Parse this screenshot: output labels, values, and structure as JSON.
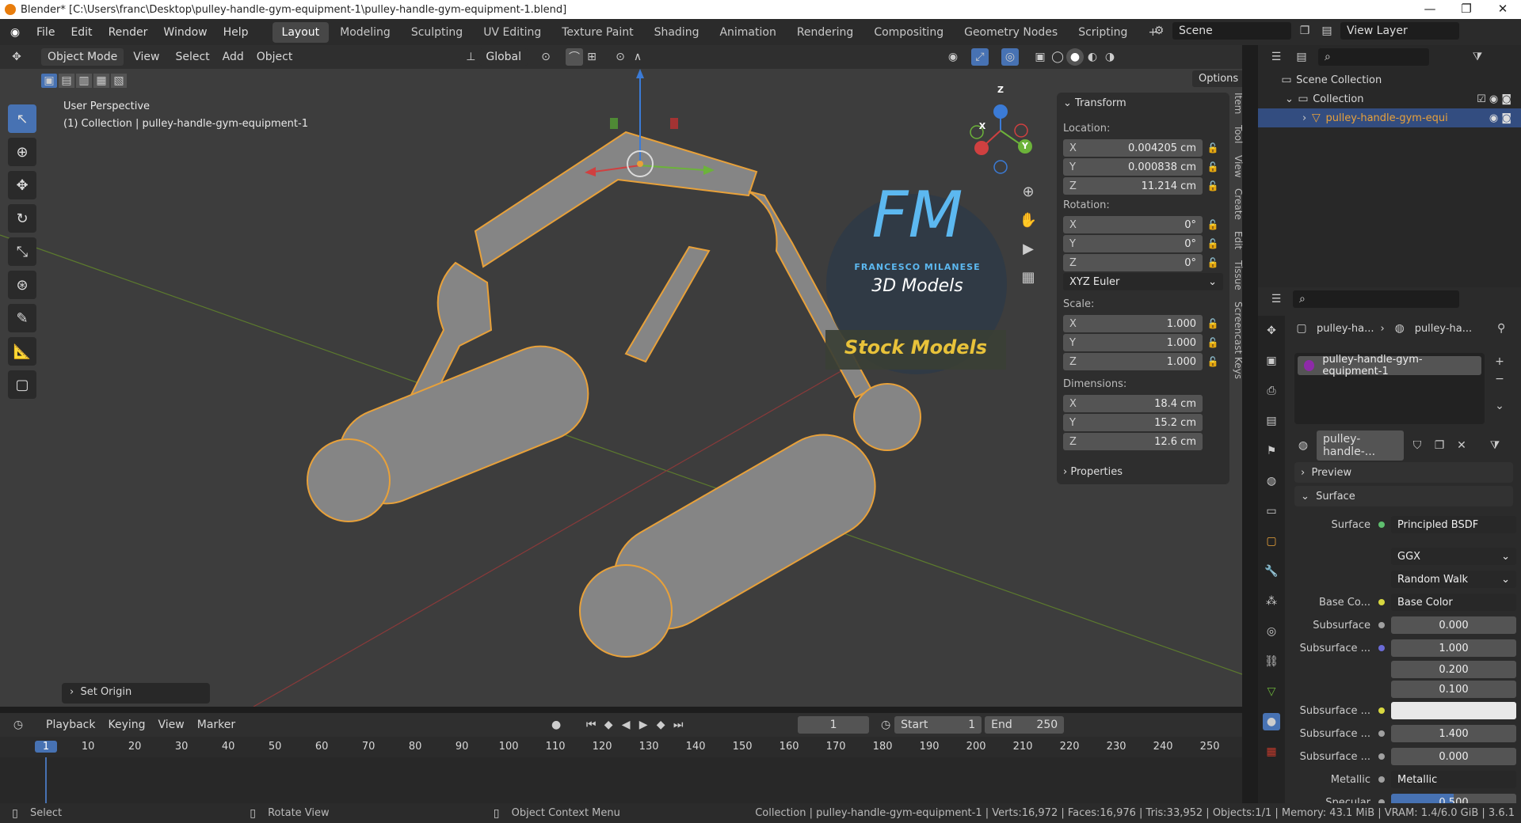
{
  "titlebar": {
    "title": "Blender* [C:\\Users\\franc\\Desktop\\pulley-handle-gym-equipment-1\\pulley-handle-gym-equipment-1.blend]",
    "minimize": "—",
    "maximize": "❐",
    "close": "✕"
  },
  "menu": {
    "items": [
      "File",
      "Edit",
      "Render",
      "Window",
      "Help"
    ]
  },
  "workspaces": [
    "Layout",
    "Modeling",
    "Sculpting",
    "UV Editing",
    "Texture Paint",
    "Shading",
    "Animation",
    "Rendering",
    "Compositing",
    "Geometry Nodes",
    "Scripting"
  ],
  "scene": {
    "label": "Scene",
    "view_layer": "View Layer"
  },
  "header3d": {
    "mode": "Object Mode",
    "view": "View",
    "select": "Select",
    "add": "Add",
    "object": "Object",
    "orientation": "Global",
    "options": "Options"
  },
  "viewport": {
    "perspective": "User Perspective",
    "collection_info": "(1) Collection | pulley-handle-gym-equipment-1",
    "watermark_letters": "FM",
    "watermark_name": "FRANCESCO MILANESE",
    "watermark_sub": "3D Models",
    "stock": "Stock Models",
    "operator": "Set Origin",
    "gizmo_x": "X",
    "gizmo_y": "Y",
    "gizmo_z": "Z"
  },
  "npanel": {
    "header": "Transform",
    "location_label": "Location:",
    "location": [
      {
        "ax": "X",
        "v": "0.004205 cm"
      },
      {
        "ax": "Y",
        "v": "0.000838 cm"
      },
      {
        "ax": "Z",
        "v": "11.214 cm"
      }
    ],
    "rotation_label": "Rotation:",
    "rotation": [
      {
        "ax": "X",
        "v": "0°"
      },
      {
        "ax": "Y",
        "v": "0°"
      },
      {
        "ax": "Z",
        "v": "0°"
      }
    ],
    "rot_mode": "XYZ Euler",
    "scale_label": "Scale:",
    "scale": [
      {
        "ax": "X",
        "v": "1.000"
      },
      {
        "ax": "Y",
        "v": "1.000"
      },
      {
        "ax": "Z",
        "v": "1.000"
      }
    ],
    "dims_label": "Dimensions:",
    "dims": [
      {
        "ax": "X",
        "v": "18.4 cm"
      },
      {
        "ax": "Y",
        "v": "15.2 cm"
      },
      {
        "ax": "Z",
        "v": "12.6 cm"
      }
    ],
    "properties": "Properties"
  },
  "side_tabs": [
    "Item",
    "Tool",
    "View",
    "Create",
    "Edit",
    "Tissue",
    "Screencast Keys"
  ],
  "outliner": {
    "scene_collection": "Scene Collection",
    "collection": "Collection",
    "object": "pulley-handle-gym-equi"
  },
  "properties": {
    "crumb1": "pulley-ha...",
    "crumb2": "pulley-ha...",
    "material_slot": "pulley-handle-gym-equipment-1",
    "material_name": "pulley-handle-...",
    "preview": "Preview",
    "surface_panel": "Surface",
    "rows": [
      {
        "lb": "Surface",
        "val": "Principled BSDF",
        "dot": "#5fbf6f",
        "kind": "dd"
      },
      {
        "lb": "",
        "val": "GGX",
        "dot": "",
        "kind": "dd"
      },
      {
        "lb": "",
        "val": "Random Walk",
        "dot": "",
        "kind": "dd"
      },
      {
        "lb": "Base Co...",
        "val": "Base Color",
        "dot": "#d8d840",
        "kind": "dd"
      },
      {
        "lb": "Subsurface",
        "val": "0.000",
        "dot": "#a0a0a0",
        "kind": "num"
      },
      {
        "lb": "Subsurface ...",
        "val": "1.000",
        "dot": "#6b6bd6",
        "kind": "num"
      },
      {
        "lb": "",
        "val": "0.200",
        "dot": "",
        "kind": "num"
      },
      {
        "lb": "",
        "val": "0.100",
        "dot": "",
        "kind": "num"
      },
      {
        "lb": "Subsurface ...",
        "val": "",
        "dot": "#d8d840",
        "kind": "white"
      },
      {
        "lb": "Subsurface ...",
        "val": "1.400",
        "dot": "#a0a0a0",
        "kind": "num"
      },
      {
        "lb": "Subsurface ...",
        "val": "0.000",
        "dot": "#a0a0a0",
        "kind": "num"
      },
      {
        "lb": "Metallic",
        "val": "Metallic",
        "dot": "#a0a0a0",
        "kind": "dd"
      },
      {
        "lb": "Specular",
        "val": "0.500",
        "dot": "#a0a0a0",
        "kind": "blue"
      }
    ]
  },
  "timeline": {
    "playback": "Playback",
    "keying": "Keying",
    "view": "View",
    "marker": "Marker",
    "current_frame": "1",
    "start_label": "Start",
    "start": "1",
    "end_label": "End",
    "end": "250",
    "ticks": [
      "1",
      "10",
      "20",
      "30",
      "40",
      "50",
      "60",
      "70",
      "80",
      "90",
      "100",
      "110",
      "120",
      "130",
      "140",
      "150",
      "160",
      "170",
      "180",
      "190",
      "200",
      "210",
      "220",
      "230",
      "240",
      "250"
    ]
  },
  "statusbar": {
    "select": "Select",
    "rotate": "Rotate View",
    "context": "Object Context Menu",
    "info": "Collection | pulley-handle-gym-equipment-1 | Verts:16,972 | Faces:16,976 | Tris:33,952 | Objects:1/1 | Memory: 43.1 MiB | VRAM: 1.4/6.0 GiB | 3.6.1"
  },
  "colors": {
    "accent": "#4772b3",
    "selection": "#e8a13a",
    "bg": "#3d3d3d"
  }
}
